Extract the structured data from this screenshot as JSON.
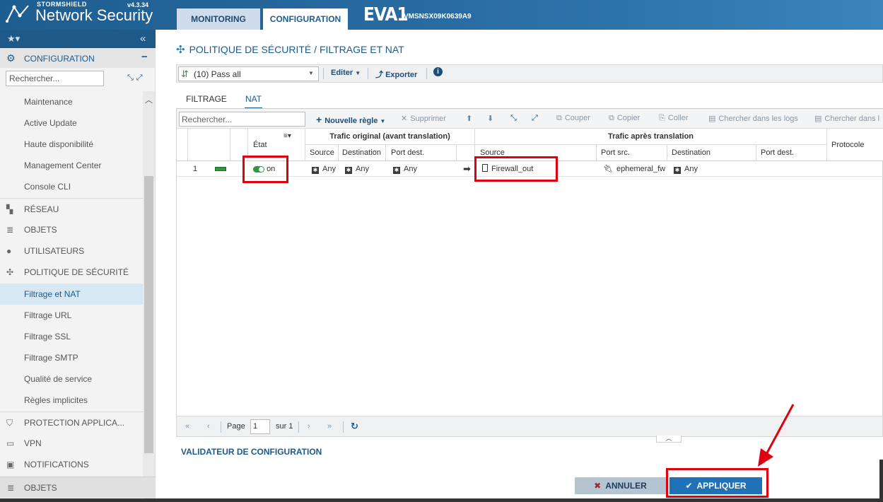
{
  "header": {
    "brand_small": "STORMSHIELD",
    "brand_name": "Network Security",
    "version": "v4.3.34",
    "tabs": [
      {
        "label": "MONITORING"
      },
      {
        "label": "CONFIGURATION"
      }
    ],
    "device_name": "EVA1",
    "serial": "VMSNSX09K0639A9"
  },
  "sidebar": {
    "favorites_icon": "star-icon",
    "section_title": "CONFIGURATION",
    "search_placeholder": "Rechercher...",
    "items": [
      {
        "label": "Maintenance"
      },
      {
        "label": "Active Update"
      },
      {
        "label": "Haute disponibilité"
      },
      {
        "label": "Management Center"
      },
      {
        "label": "Console CLI"
      },
      {
        "label": "RÉSEAU"
      },
      {
        "label": "OBJETS"
      },
      {
        "label": "UTILISATEURS"
      },
      {
        "label": "POLITIQUE DE SÉCURITÉ"
      },
      {
        "label": "Filtrage et NAT"
      },
      {
        "label": "Filtrage URL"
      },
      {
        "label": "Filtrage SSL"
      },
      {
        "label": "Filtrage SMTP"
      },
      {
        "label": "Qualité de service"
      },
      {
        "label": "Règles implicites"
      },
      {
        "label": "PROTECTION APPLICA..."
      },
      {
        "label": "VPN"
      },
      {
        "label": "NOTIFICATIONS"
      }
    ],
    "bottom_section": "OBJETS"
  },
  "page": {
    "title": "POLITIQUE DE SÉCURITÉ / FILTRAGE ET NAT",
    "policy_selected": "(10) Pass all",
    "edit_label": "Editer",
    "export_label": "Exporter",
    "tabs": [
      {
        "label": "FILTRAGE"
      },
      {
        "label": "NAT"
      }
    ],
    "active_tab": "NAT"
  },
  "grid_toolbar": {
    "search_placeholder": "Rechercher...",
    "new_rule": "Nouvelle règle",
    "delete": "Supprimer",
    "cut": "Couper",
    "copy": "Copier",
    "paste": "Coller",
    "search_logs": "Chercher dans les logs",
    "search_in": "Chercher dans l"
  },
  "table": {
    "headers": {
      "state": "État",
      "original_group": "Trafic original (avant translation)",
      "translated_group": "Trafic après translation",
      "protocol": "Protocole",
      "orig_source": "Source",
      "orig_destination": "Destination",
      "orig_port_dest": "Port dest.",
      "tr_source": "Source",
      "tr_port_src": "Port src.",
      "tr_destination": "Destination",
      "tr_port_dest": "Port dest."
    },
    "rows": [
      {
        "num": "1",
        "state": "on",
        "orig_source": "Any",
        "orig_destination": "Any",
        "orig_port_dest": "Any",
        "tr_source": "Firewall_out",
        "tr_port_src": "ephemeral_fw",
        "tr_destination": "Any",
        "tr_port_dest": ""
      }
    ]
  },
  "pager": {
    "page_label": "Page",
    "page_value": "1",
    "of_label": "sur 1"
  },
  "footer": {
    "validator": "VALIDATEUR DE CONFIGURATION",
    "cancel": "ANNULER",
    "apply": "APPLIQUER"
  },
  "colors": {
    "header_blue": "#1e5d8f",
    "accent": "#1f72b8",
    "highlight_red": "#e0000f",
    "toggle_green": "#2f9a3b"
  }
}
